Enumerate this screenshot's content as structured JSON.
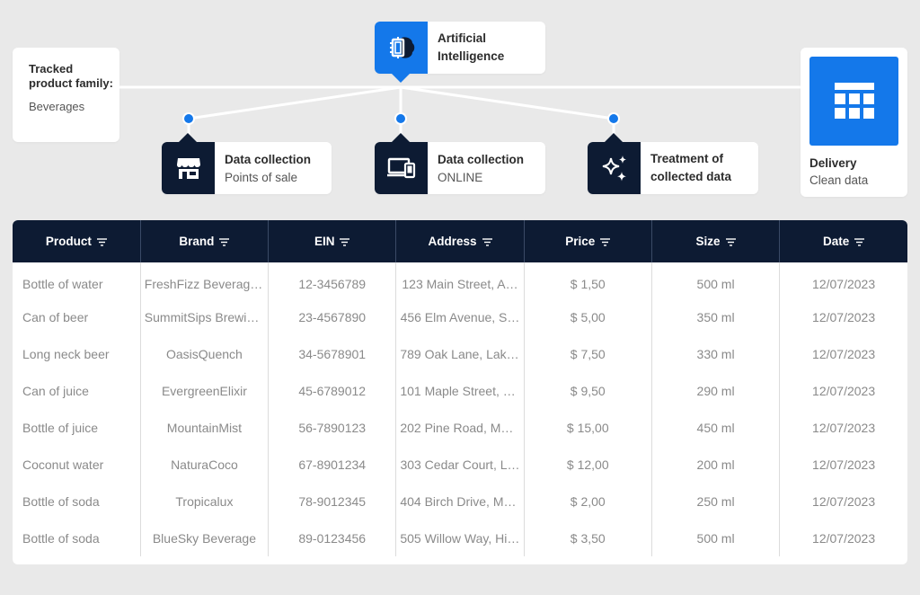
{
  "colors": {
    "accent": "#1478ea",
    "navy": "#0d1b33",
    "background": "#e9e9e9"
  },
  "tracked": {
    "title": "Tracked product family:",
    "value": "Beverages"
  },
  "ai": {
    "icon": "ai-chip-brain-icon",
    "line1": "Artificial",
    "line2": "Intelligence"
  },
  "steps": [
    {
      "icon": "store-icon",
      "title": "Data collection",
      "subtitle": "Points of sale"
    },
    {
      "icon": "devices-icon",
      "title": "Data collection",
      "subtitle": "ONLINE"
    },
    {
      "icon": "sparkles-icon",
      "line1": "Treatment of",
      "line2": "collected data"
    }
  ],
  "delivery": {
    "icon": "table-grid-icon",
    "title": "Delivery",
    "subtitle": "Clean data"
  },
  "table": {
    "filter_icon": "filter-icon",
    "columns": [
      "Product",
      "Brand",
      "EIN",
      "Address",
      "Price",
      "Size",
      "Date"
    ],
    "rows": [
      [
        "Bottle of water",
        "FreshFizz Beverages…",
        "12-3456789",
        "123 Main Street, A…",
        "$ 1,50",
        "500 ml",
        "12/07/2023"
      ],
      [
        "Can of beer",
        "SummitSips Brewin…",
        "23-4567890",
        "456 Elm Avenue, S…",
        "$ 5,00",
        "350 ml",
        "12/07/2023"
      ],
      [
        "Long neck beer",
        "OasisQuench",
        "34-5678901",
        "789 Oak Lane, Lake…",
        "$ 7,50",
        "330 ml",
        "12/07/2023"
      ],
      [
        "Can of juice",
        "EvergreenElixir",
        "45-6789012",
        "101 Maple Street, R…",
        "$ 9,50",
        "290 ml",
        "12/07/2023"
      ],
      [
        "Bottle of juice",
        "MountainMist",
        "56-7890123",
        "202 Pine Road, Mo…",
        "$ 15,00",
        "450 ml",
        "12/07/2023"
      ],
      [
        "Coconut water",
        "NaturaCoco",
        "67-8901234",
        "303 Cedar Court, L…",
        "$ 12,00",
        "200 ml",
        "12/07/2023"
      ],
      [
        "Bottle of soda",
        "Tropicalux",
        "78-9012345",
        "404 Birch Drive, Me…",
        "$ 2,00",
        "250 ml",
        "12/07/2023"
      ],
      [
        "Bottle of soda",
        "BlueSky Beverage",
        "89-0123456",
        "505 Willow Way, Hil…",
        "$ 3,50",
        "500 ml",
        "12/07/2023"
      ]
    ]
  }
}
